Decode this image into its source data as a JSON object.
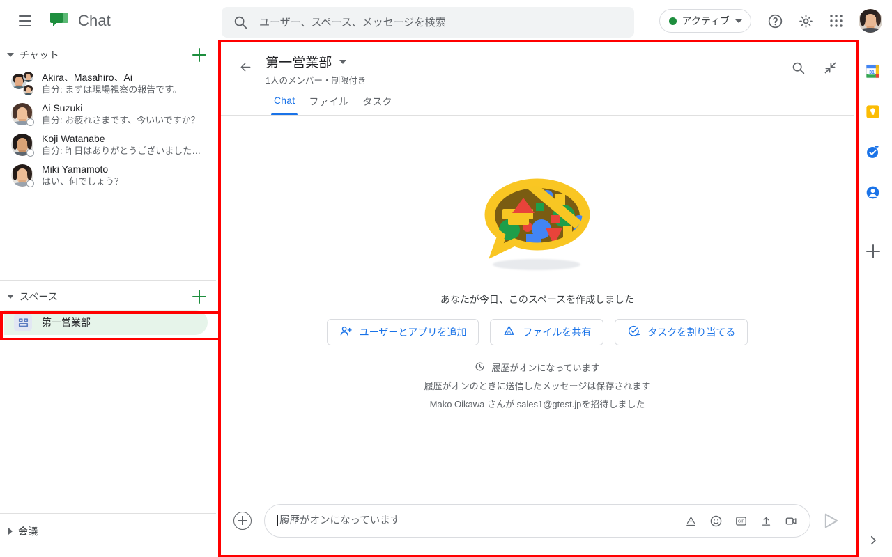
{
  "app": {
    "name": "Chat",
    "logo_icon": "chat-bubble-logo",
    "menu_icon": "hamburger-menu-icon"
  },
  "search": {
    "placeholder": "ユーザー、スペース、メッセージを検索",
    "value": "",
    "icon": "search-icon"
  },
  "topbar": {
    "status_label": "アクティブ",
    "status_color": "#1e8e3e",
    "status_caret_icon": "chevron-down-icon",
    "help_icon": "help-circle-icon",
    "settings_icon": "gear-icon",
    "apps_icon": "apps-grid-icon",
    "avatar_icon": "user-avatar"
  },
  "sidebar": {
    "chat_section": {
      "title": "チャット",
      "expanded": true,
      "add_icon": "plus-icon",
      "items": [
        {
          "name": "Akira、Masahiro、Ai",
          "snippet": "自分: まずは現場視察の報告です。",
          "avatar": "group-avatar"
        },
        {
          "name": "Ai Suzuki",
          "snippet": "自分: お疲れさまです、今いいですか？",
          "avatar": "user-avatar"
        },
        {
          "name": "Koji Watanabe",
          "snippet": "自分: 昨日はありがとうございました…",
          "avatar": "user-avatar"
        },
        {
          "name": "Miki Yamamoto",
          "snippet": "はい、何でしょう？",
          "avatar": "user-avatar"
        }
      ]
    },
    "spaces_section": {
      "title": "スペース",
      "expanded": true,
      "add_icon": "plus-icon",
      "items": [
        {
          "name": "第一営業部",
          "icon": "space-icon",
          "selected": true
        }
      ]
    },
    "meetings_section": {
      "title": "会議",
      "expanded": false
    }
  },
  "main": {
    "back_icon": "arrow-left-icon",
    "title": "第一営業部",
    "title_caret_icon": "chevron-down-icon",
    "subtitle": "1人のメンバー・制限付き",
    "search_icon": "search-icon",
    "collapse_icon": "collapse-arrows-icon",
    "tabs": [
      {
        "label": "Chat",
        "active": true
      },
      {
        "label": "ファイル",
        "active": false
      },
      {
        "label": "タスク",
        "active": false
      }
    ],
    "empty_state": {
      "illustration": "speech-bubble-shapes-illustration",
      "created_text": "あなたが今日、このスペースを作成しました",
      "actions": [
        {
          "label": "ユーザーとアプリを追加",
          "icon": "person-add-icon"
        },
        {
          "label": "ファイルを共有",
          "icon": "drive-icon"
        },
        {
          "label": "タスクを割り当てる",
          "icon": "task-add-icon"
        }
      ],
      "history_icon": "history-clock-icon",
      "history_on": "履歴がオンになっています",
      "history_note": "履歴がオンのときに送信したメッセージは保存されます",
      "invite_note": "Mako Oikawa さんが sales1@gtest.jpを招待しました"
    },
    "composer": {
      "add_icon": "plus-circle-icon",
      "placeholder": "履歴がオンになっています",
      "value": "",
      "icons": [
        {
          "name": "format-text-icon",
          "glyph": "A"
        },
        {
          "name": "emoji-icon",
          "glyph": "☺"
        },
        {
          "name": "gif-icon",
          "glyph": "GIF"
        },
        {
          "name": "upload-icon",
          "glyph": "↥"
        },
        {
          "name": "video-meeting-icon",
          "glyph": "▭"
        }
      ],
      "send_icon": "send-icon"
    }
  },
  "rail": {
    "items": [
      {
        "name": "calendar-icon",
        "label": "31"
      },
      {
        "name": "keep-icon",
        "label": ""
      },
      {
        "name": "tasks-icon",
        "label": ""
      },
      {
        "name": "contacts-icon",
        "label": ""
      }
    ],
    "add_icon": "plus-icon",
    "expand_icon": "chevron-right-icon"
  },
  "annotations": {
    "highlight_color": "#ff0000",
    "boxes": [
      "main-chat-panel",
      "space-list-item"
    ]
  }
}
